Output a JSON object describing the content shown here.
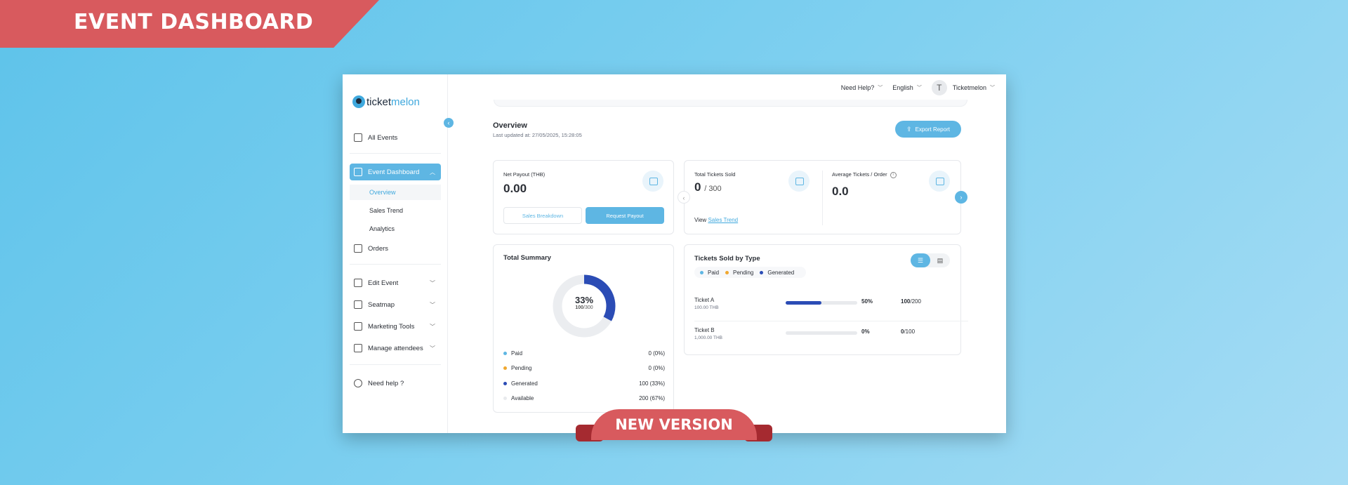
{
  "banner": {
    "title": "EVENT DASHBOARD",
    "badge": "NEW VERSION"
  },
  "brand": {
    "prefix": "ticket",
    "suffix": "melon"
  },
  "topbar": {
    "help": "Need Help?",
    "language": "English",
    "avatar_initial": "T",
    "account": "Ticketmelon"
  },
  "sidebar": {
    "all_events": "All Events",
    "event_dashboard": "Event Dashboard",
    "sub_items": [
      "Overview",
      "Sales Trend",
      "Analytics"
    ],
    "orders": "Orders",
    "edit_event": "Edit Event",
    "seatmap": "Seatmap",
    "marketing_tools": "Marketing Tools",
    "manage_attendees": "Manage attendees",
    "need_help": "Need help ?"
  },
  "overview": {
    "title": "Overview",
    "last_updated": "Last updated at: 27/05/2025, 15:28:05",
    "export_label": "Export Report"
  },
  "net_payout": {
    "label": "Net Payout (THB)",
    "value": "0.00",
    "breakdown_label": "Sales Breakdown",
    "payout_label": "Request Payout"
  },
  "tickets_sold": {
    "label": "Total Tickets Sold",
    "value": "0",
    "total": "/ 300",
    "view_prefix": "View",
    "view_link": "Sales Trend"
  },
  "avg_tickets": {
    "label": "Average Tickets / Order",
    "value": "0.0"
  },
  "total_summary": {
    "title": "Total Summary",
    "center_pct": "33%",
    "center_bold": "100",
    "center_total": "/300",
    "filled_fraction": 0.33,
    "rows": [
      {
        "label": "Paid",
        "value": "0 (0%)",
        "color": "#5eb6e3"
      },
      {
        "label": "Pending",
        "value": "0 (0%)",
        "color": "#f0a830"
      },
      {
        "label": "Generated",
        "value": "100 (33%)",
        "color": "#2b4cb5"
      },
      {
        "label": "Available",
        "value": "200 (67%)",
        "color": "#e8eaed"
      }
    ]
  },
  "by_type": {
    "title": "Tickets Sold by Type",
    "legend": [
      {
        "label": "Paid",
        "color": "#5eb6e3"
      },
      {
        "label": "Pending",
        "color": "#f0a830"
      },
      {
        "label": "Generated",
        "color": "#2b4cb5"
      }
    ],
    "tickets": [
      {
        "name": "Ticket A",
        "price": "100.00 THB",
        "pct": "50%",
        "fill": 0.5,
        "sold": "100",
        "total": "/200"
      },
      {
        "name": "Ticket B",
        "price": "1,000.00 THB",
        "pct": "0%",
        "fill": 0,
        "sold": "0",
        "total": "/100"
      }
    ]
  }
}
